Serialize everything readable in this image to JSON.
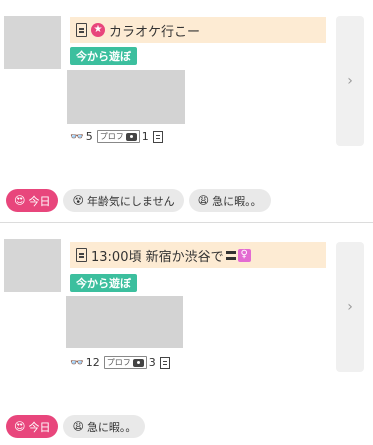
{
  "posts": [
    {
      "title": "カラオケ行こー",
      "title_prefix_icon": "doc-icon",
      "title_badge_icon": "star-icon",
      "play_badge": "今から遊ぼ",
      "views": "5",
      "profile_label": "プロフ",
      "photos": "1",
      "tags": [
        {
          "label": "今日",
          "icon": "smile-heart-eyes",
          "emoji": "😍"
        },
        {
          "label": "年齢気にしません",
          "icon": "sweat-face",
          "emoji": "😵"
        },
        {
          "label": "急に暇。。",
          "icon": "tired-face",
          "emoji": "😩"
        }
      ]
    },
    {
      "title": "13:00頃 新宿か渋谷で",
      "title_prefix_icon": "doc-icon",
      "play_badge": "今から遊ぼ",
      "views": "12",
      "profile_label": "プロフ",
      "photos": "3",
      "tags": [
        {
          "label": "今日",
          "icon": "smile-heart-eyes",
          "emoji": "😍"
        },
        {
          "label": "急に暇。。",
          "icon": "tired-face",
          "emoji": "😩"
        }
      ]
    }
  ],
  "colors": {
    "title_bg": "#fdebd3",
    "play_badge_bg": "#3cbf9e",
    "today_tag_bg": "#e8467c",
    "tag_bg": "#e9e9e9",
    "venus_icon": "#e36bd2"
  },
  "arrow_glyph": "›",
  "star_glyph": "★",
  "venus_glyph": "♀",
  "glasses_glyph": "👓"
}
